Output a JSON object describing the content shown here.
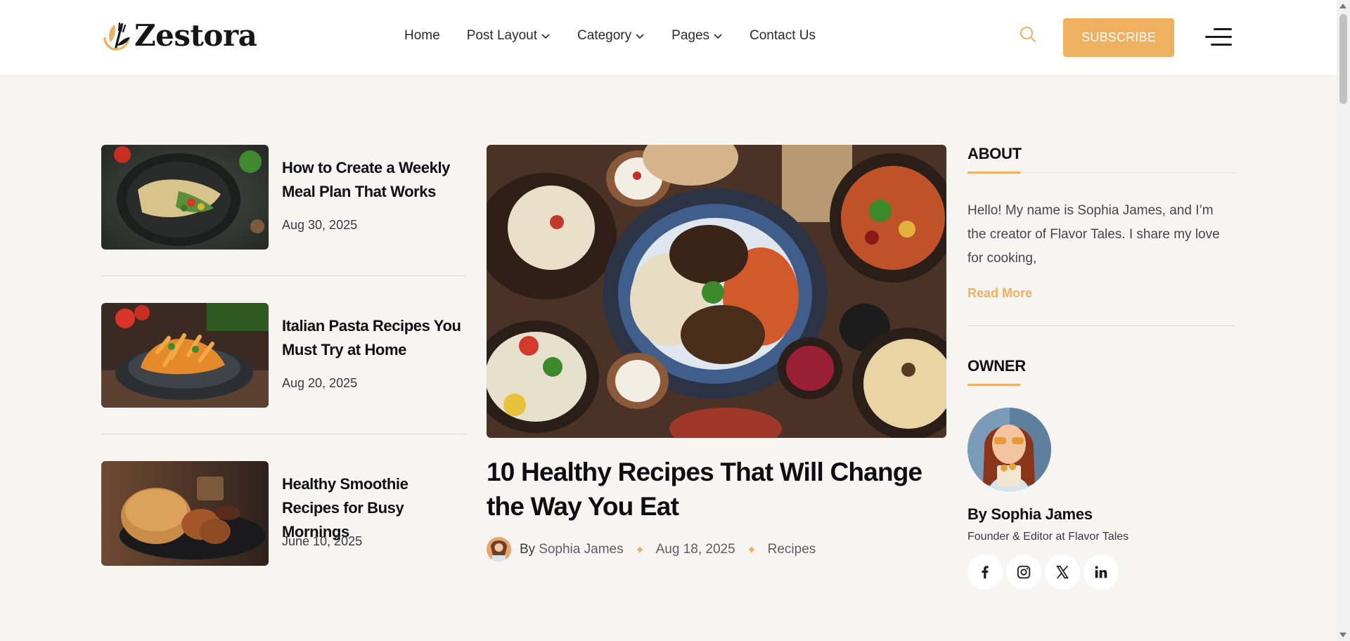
{
  "brand": {
    "name": "Zestora",
    "accent": "#efb160"
  },
  "nav": {
    "items": [
      {
        "label": "Home",
        "has_dropdown": false
      },
      {
        "label": "Post Layout",
        "has_dropdown": true
      },
      {
        "label": "Category",
        "has_dropdown": true
      },
      {
        "label": "Pages",
        "has_dropdown": true
      },
      {
        "label": "Contact Us",
        "has_dropdown": false
      }
    ],
    "search_icon": "search-icon",
    "subscribe_label": "SUBSCRIBE",
    "menu_icon": "hamburger-menu-icon"
  },
  "posts": [
    {
      "title": "How to Create a Weekly Meal Plan That Works",
      "date": "Aug 30, 2025"
    },
    {
      "title": "Italian Pasta Recipes You Must Try at Home",
      "date": "Aug 20, 2025"
    },
    {
      "title": "Healthy Smoothie Recipes for Busy Mornings",
      "date": "June 10, 2025"
    }
  ],
  "feature": {
    "title": "10 Healthy Recipes That Will Change the Way You Eat",
    "by": "By",
    "author": "Sophia James",
    "date": "Aug 18, 2025",
    "category": "Recipes"
  },
  "sidebar": {
    "about": {
      "heading": "ABOUT",
      "text": "Hello! My name is Sophia James, and I’m the creator of Flavor Tales. I share my love for cooking,",
      "read_more": "Read More"
    },
    "owner": {
      "heading": "OWNER",
      "name": "By Sophia James",
      "role": "Founder & Editor at Flavor Tales",
      "socials": [
        "facebook-icon",
        "instagram-icon",
        "x-icon",
        "linkedin-icon"
      ]
    }
  }
}
